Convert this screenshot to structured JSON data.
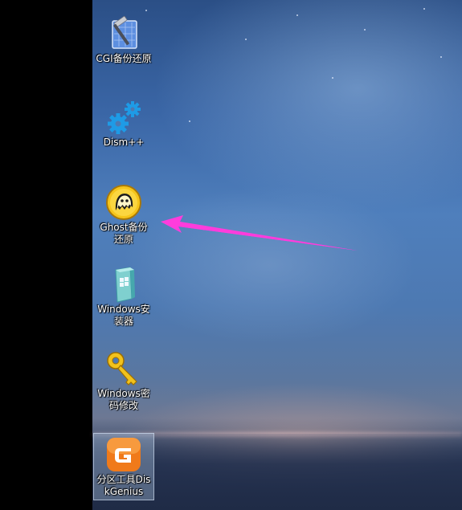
{
  "desktop": {
    "icons": [
      {
        "name": "cgi-backup-restore",
        "label": "CGI备份还原",
        "icon": "hammer-blueprint-icon"
      },
      {
        "name": "dism-plus-plus",
        "label": "Dism++",
        "icon": "gears-icon"
      },
      {
        "name": "ghost-backup-restore",
        "label": "Ghost备份还原",
        "icon": "ghost-icon"
      },
      {
        "name": "windows-installer",
        "label": "Windows安装器",
        "icon": "windows-box-icon"
      },
      {
        "name": "windows-password-reset",
        "label": "Windows密码修改",
        "icon": "key-icon"
      },
      {
        "name": "diskgenius",
        "label": "分区工具DiskGenius",
        "icon": "diskgenius-icon",
        "selected": true
      }
    ]
  },
  "annotation": {
    "arrow_color": "#ff3cdc",
    "arrow_target": "Ghost备份还原"
  },
  "colors": {
    "gear_blue": "#1e9be6",
    "ghost_yellow": "#f6c51a",
    "key_gold": "#f2c21c",
    "diskgenius_orange": "#f07a1a"
  }
}
